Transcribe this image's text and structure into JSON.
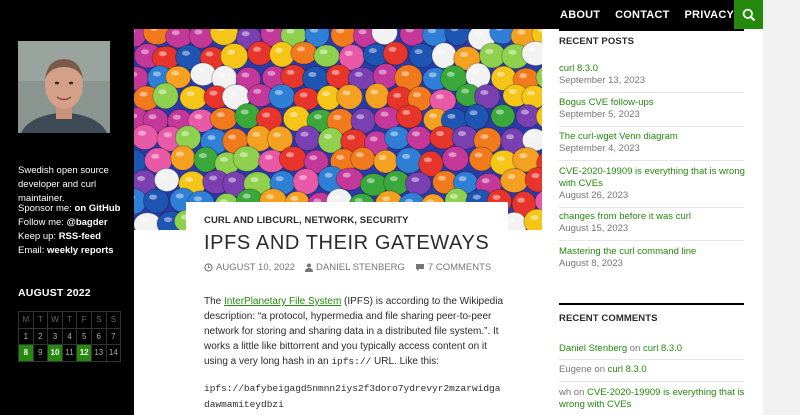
{
  "nav": {
    "items": [
      "ABOUT",
      "CONTACT",
      "PRIVACY"
    ]
  },
  "profile": {
    "bio": "Swedish open source developer and curl maintainer.",
    "links": [
      {
        "label": "Sponsor me:",
        "link": "on GitHub"
      },
      {
        "label": "Follow me:",
        "link": "@bagder"
      },
      {
        "label": "Keep up:",
        "link": "RSS-feed"
      },
      {
        "label": "Email:",
        "link": "weekly reports"
      }
    ]
  },
  "calendar": {
    "title": "AUGUST 2022",
    "headers": [
      "M",
      "T",
      "W",
      "T",
      "F",
      "S",
      "S"
    ],
    "row1": [
      "1",
      "2",
      "3",
      "4",
      "5",
      "6",
      "7"
    ],
    "row2": [
      "8",
      "9",
      "10",
      "11",
      "12",
      "13",
      "14"
    ],
    "posted_days": [
      "8",
      "10",
      "12"
    ]
  },
  "post": {
    "categories": {
      "c1": "CURL AND LIBCURL",
      "c2": "NETWORK",
      "c3": "SECURITY",
      "sep": ", "
    },
    "title": "IPFS AND THEIR GATEWAYS",
    "date": "AUGUST 10, 2022",
    "author": "DANIEL STENBERG",
    "comments": "7 COMMENTS",
    "intro_before": "The ",
    "intro_link": "InterPlanetary File System",
    "intro_after": " (IPFS) is according to the Wikipedia description: “a protocol, hypermedia and file sharing peer-to-peer network for storing and sharing data in a distributed file system.”. It works a little like bittorrent and you typically access content on it using a very long hash in an ",
    "intro_code": "ipfs://",
    "intro_end": " URL. Like this:",
    "code_line1": "ipfs://bafybeigagd5nmnn2iys2f3doro7ydrevyr2mzarwidga",
    "code_line2": "dawmamiteydbzi"
  },
  "recent_posts": {
    "title": "RECENT POSTS",
    "items": [
      {
        "title": "curl 8.3.0",
        "date": "September 13, 2023"
      },
      {
        "title": "Bogus CVE follow-ups",
        "date": "September 5, 2023"
      },
      {
        "title": "The curl-wget Venn diagram",
        "date": "September 4, 2023"
      },
      {
        "title": "CVE-2020-19909 is everything that is wrong with CVEs",
        "date": "August 26, 2023"
      },
      {
        "title": "changes from before it was curl",
        "date": "August 15, 2023"
      },
      {
        "title": "Mastering the curl command line",
        "date": "August 8, 2023"
      }
    ]
  },
  "recent_comments": {
    "title": "RECENT COMMENTS",
    "items": [
      {
        "author": "Daniel Stenberg",
        "on": " on ",
        "post": "curl 8.3.0"
      },
      {
        "author": "Eugene",
        "on": " on ",
        "post": "curl 8.3.0"
      },
      {
        "author": "wh",
        "on": " on ",
        "post": "CVE-2020-19909 is everything that is wrong with CVEs"
      }
    ]
  },
  "colors": {
    "accent": "#24890d",
    "topbar": "#000000"
  },
  "icons": {
    "search": "search-icon",
    "clock": "clock-icon",
    "user": "user-icon",
    "comment": "comment-icon"
  }
}
